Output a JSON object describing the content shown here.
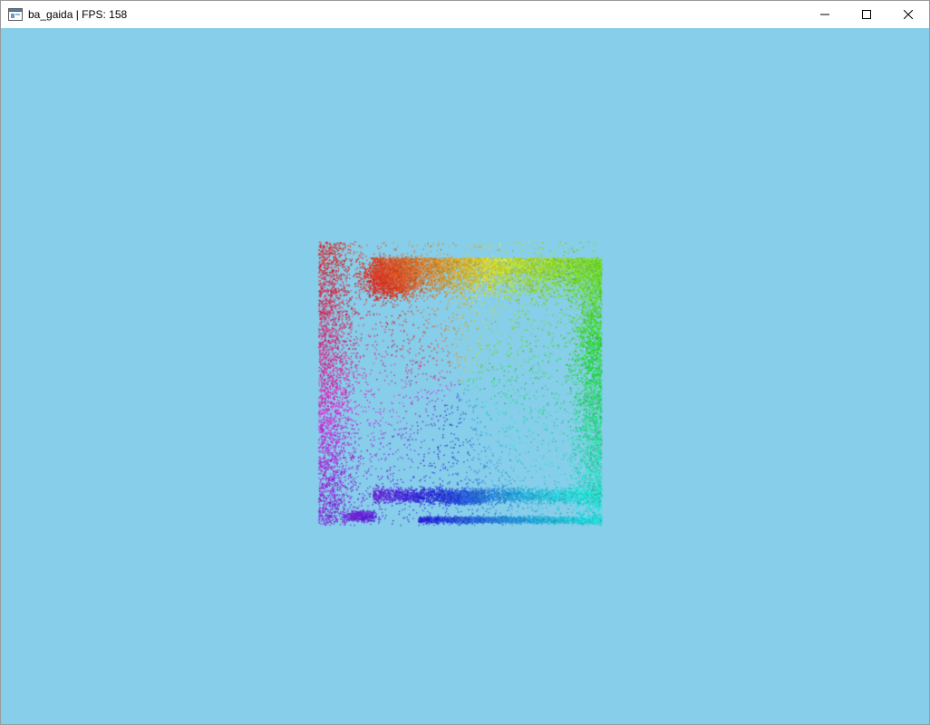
{
  "window": {
    "title": "ba_gaida | FPS: 158",
    "icon": "application-window-icon",
    "controls": [
      "minimize-icon",
      "maximize-icon",
      "close-icon"
    ]
  },
  "viewport": {
    "background_color": "#87ceea",
    "content": "point-cloud"
  }
}
